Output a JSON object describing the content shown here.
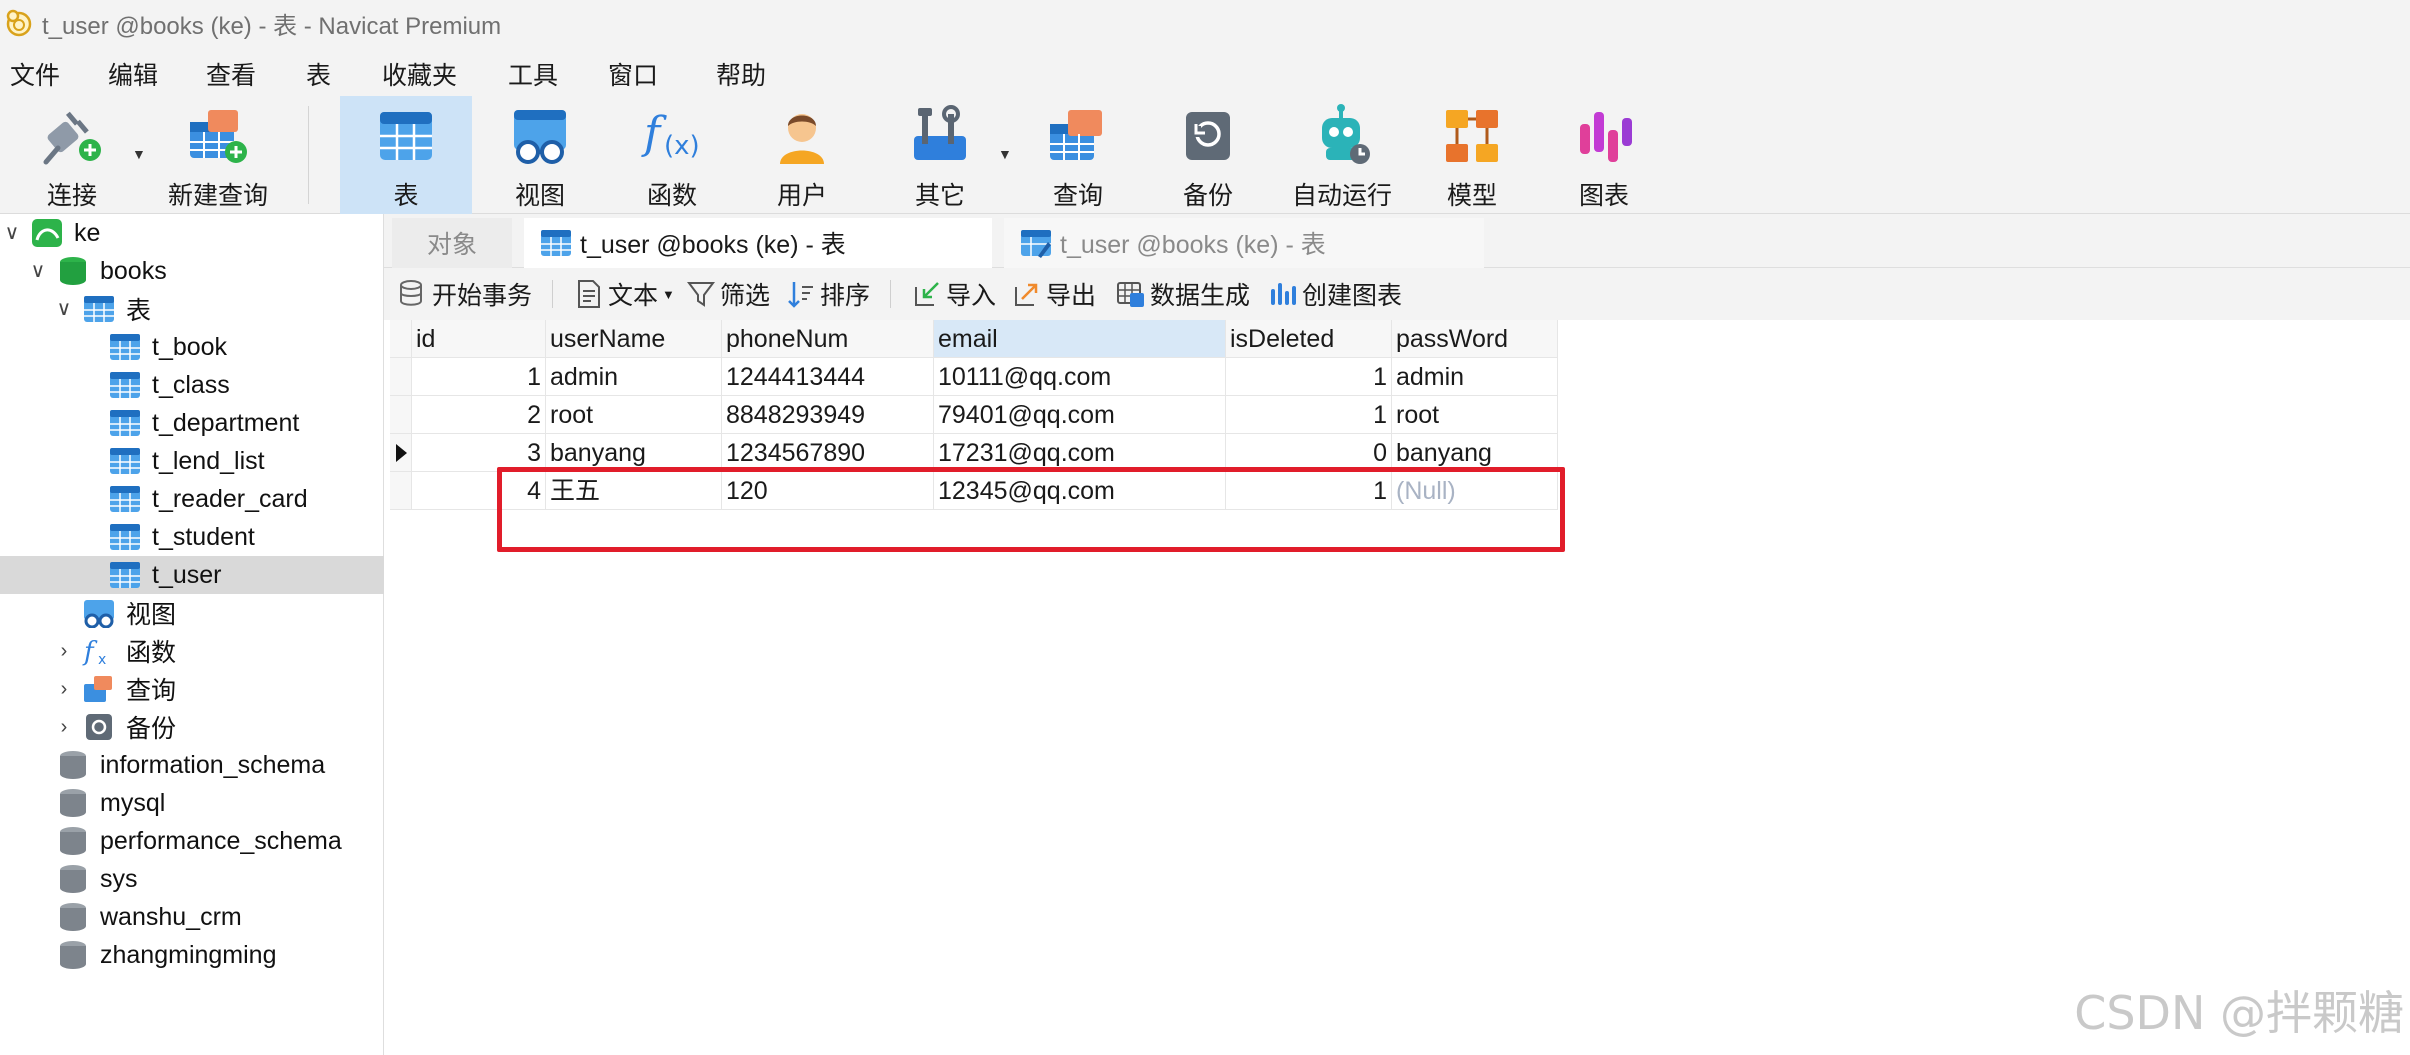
{
  "window": {
    "title": "t_user @books (ke) - 表 - Navicat Premium"
  },
  "menu": [
    "文件",
    "编辑",
    "查看",
    "表",
    "收藏夹",
    "工具",
    "窗口",
    "帮助"
  ],
  "toolbar": {
    "connect": "连接",
    "new_query": "新建查询",
    "table": "表",
    "view": "视图",
    "function": "函数",
    "user": "用户",
    "other": "其它",
    "query": "查询",
    "backup": "备份",
    "automation": "自动运行",
    "model": "模型",
    "chart": "图表"
  },
  "tree": {
    "connection": "ke",
    "database": "books",
    "tables_group": "表",
    "tables": [
      "t_book",
      "t_class",
      "t_department",
      "t_lend_list",
      "t_reader_card",
      "t_student",
      "t_user"
    ],
    "selected_table": "t_user",
    "views_group": "视图",
    "functions_group": "函数",
    "queries_group": "查询",
    "backups_group": "备份",
    "other_databases": [
      "information_schema",
      "mysql",
      "performance_schema",
      "sys",
      "wanshu_crm",
      "zhangmingming"
    ]
  },
  "tabs": {
    "objects": "对象",
    "active": "t_user @books (ke) - 表",
    "inactive": "t_user @books (ke) - 表"
  },
  "actions": {
    "begin_transaction": "开始事务",
    "text": "文本",
    "filter": "筛选",
    "sort": "排序",
    "import": "导入",
    "export": "导出",
    "data_generation": "数据生成",
    "create_chart": "创建图表"
  },
  "table": {
    "columns": [
      "id",
      "userName",
      "phoneNum",
      "email",
      "isDeleted",
      "passWord"
    ],
    "selected_column": "email",
    "rows": [
      [
        "1",
        "admin",
        "1244413444",
        "10111@qq.com",
        "1",
        "admin"
      ],
      [
        "2",
        "root",
        "8848293949",
        "79401@qq.com",
        "1",
        "root"
      ],
      [
        "3",
        "banyang",
        "1234567890",
        "17231@qq.com",
        "0",
        "banyang"
      ],
      [
        "4",
        "王五",
        "120",
        "12345@qq.com",
        "1",
        "(Null)"
      ]
    ],
    "current_row": 3,
    "highlight_color": "#e11d2a"
  },
  "watermark": "CSDN @拌颗糖"
}
